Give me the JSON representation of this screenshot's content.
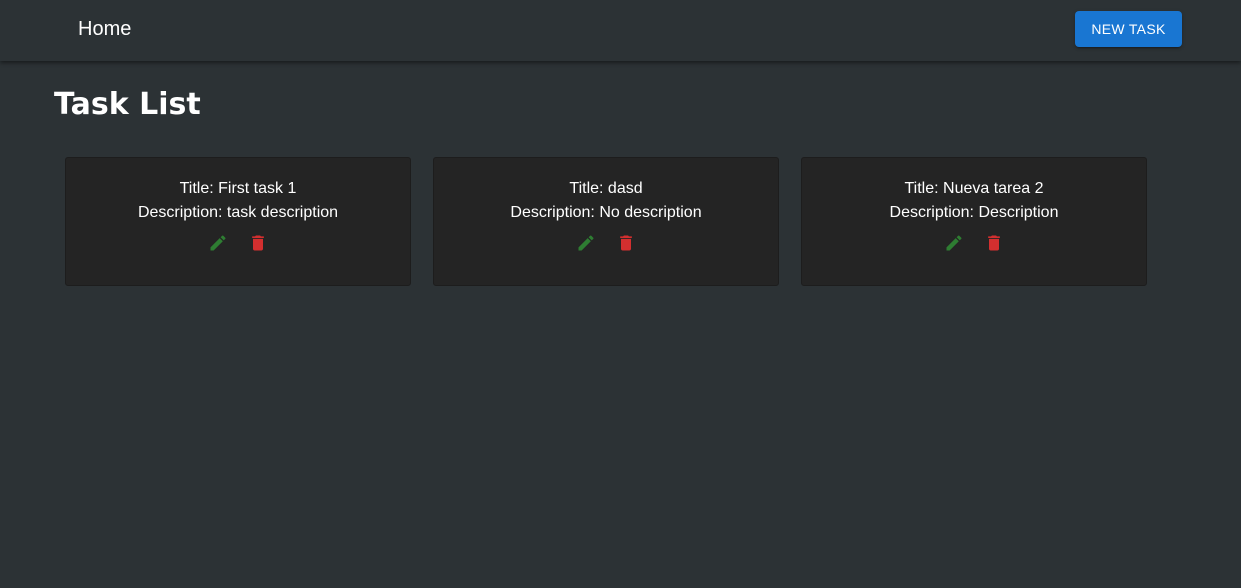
{
  "header": {
    "home_label": "Home",
    "new_task_label": "NEW TASK"
  },
  "page": {
    "title": "Task List"
  },
  "tasks": [
    {
      "title_line": "Title: First task 1",
      "description_line": "Description: task description"
    },
    {
      "title_line": "Title: dasd",
      "description_line": "Description: No description"
    },
    {
      "title_line": "Title: Nueva tarea 2",
      "description_line": "Description: Description"
    }
  ],
  "icons": {
    "edit": "pencil-icon",
    "delete": "trash-icon"
  },
  "colors": {
    "background": "#2c3235",
    "card": "#242424",
    "primary": "#1976d2",
    "edit": "#2e7d32",
    "delete": "#d32f2f"
  }
}
